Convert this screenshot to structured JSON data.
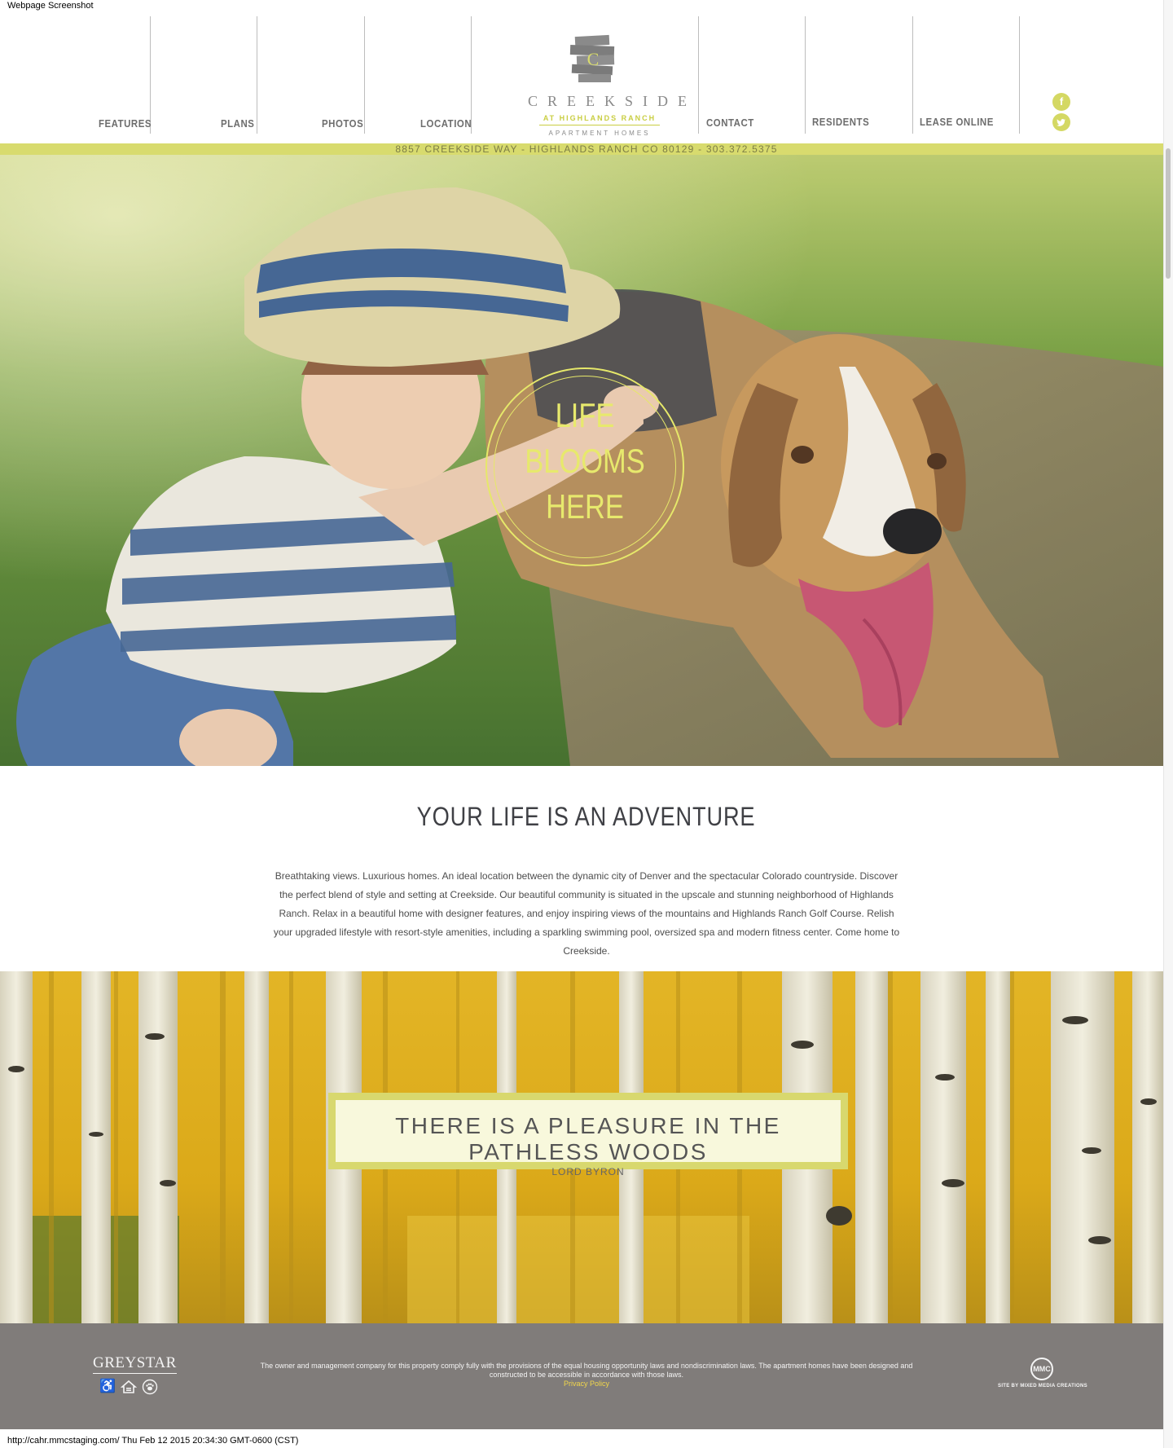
{
  "page": {
    "screenshot_label": "Webpage Screenshot",
    "url_label": "http://cahr.mmcstaging.com/ Thu Feb 12 2015 20:34:30 GMT-0600 (CST)"
  },
  "nav": {
    "left": [
      "FEATURES",
      "PLANS",
      "PHOTOS",
      "LOCATION"
    ],
    "right": [
      "CONTACT",
      "RESIDENTS",
      "LEASE ONLINE"
    ]
  },
  "logo": {
    "mark_letter": "C",
    "name": "CREEKSIDE",
    "tagline": "AT HIGHLANDS RANCH",
    "subtitle": "APARTMENT HOMES"
  },
  "social": {
    "facebook_glyph": "f",
    "twitter_glyph": "t",
    "icons": [
      "facebook-icon",
      "twitter-icon"
    ]
  },
  "address": "8857 CREEKSIDE WAY - HIGHLANDS RANCH CO 80129 - 303.372.5375",
  "hero": {
    "line1": "LIFE",
    "line2": "BLOOMS",
    "line3": "HERE"
  },
  "intro": {
    "title": "YOUR LIFE IS AN ADVENTURE",
    "body": "Breathtaking views. Luxurious homes. An ideal location between the dynamic city of Denver and the spectacular Colorado countryside. Discover the perfect blend of style and setting at Creekside. Our beautiful community is situated in the upscale and stunning neighborhood of Highlands Ranch. Relax in a beautiful home with designer features, and enjoy inspiring views of the mountains and Highlands Ranch Golf Course. Relish your upgraded lifestyle with resort-style amenities, including a sparkling swimming pool, oversized spa and modern fitness center. Come home to Creekside."
  },
  "quote": {
    "text": "THERE IS A PLEASURE IN THE PATHLESS WOODS",
    "author": "LORD BYRON"
  },
  "footer": {
    "brand": "GREYSTAR",
    "icons": [
      "accessibility-icon",
      "equal-housing-icon",
      "pet-friendly-icon"
    ],
    "disclaimer": "The owner and management company for this property comply fully with the provisions of the equal housing opportunity laws and nondiscrimination laws. The apartment homes have been designed and constructed to be accessible in accordance with those laws.",
    "privacy_link": "Privacy Policy",
    "credit_mark": "MMC",
    "credit": "SITE BY MIXED MEDIA CREATIONS"
  },
  "colors": {
    "accent": "#d8db6e",
    "hero_text": "#e7e96d",
    "footer_bg": "#807c7a",
    "footer_link": "#f1d64b"
  }
}
